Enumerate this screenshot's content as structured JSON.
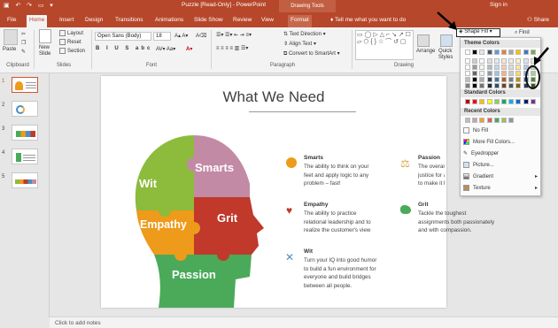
{
  "window": {
    "title": "Puzzle [Read-Only] - PowerPoint",
    "context_tab": "Drawing Tools",
    "signin": "Sign in"
  },
  "tabs": [
    "File",
    "Home",
    "Insert",
    "Design",
    "Transitions",
    "Animations",
    "Slide Show",
    "Review",
    "View",
    "Format"
  ],
  "tell_me": "Tell me what you want to do",
  "share": "Share",
  "ribbon": {
    "clipboard": {
      "paste": "Paste",
      "label": "Clipboard"
    },
    "slides": {
      "new_slide": "New Slide",
      "layout": "Layout",
      "reset": "Reset",
      "section": "Section",
      "label": "Slides"
    },
    "font": {
      "name": "Open Sans (Body)",
      "size": "18",
      "label": "Font"
    },
    "paragraph": {
      "text_direction": "Text Direction",
      "align_text": "Align Text",
      "smartart": "Convert to SmartArt",
      "label": "Paragraph"
    },
    "drawing": {
      "arrange": "Arrange",
      "quick_styles": "Quick Styles",
      "label": "Drawing",
      "shape_fill": "Shape Fill"
    },
    "editing": {
      "find": "Find"
    }
  },
  "shape_fill_menu": {
    "theme_colors": "Theme Colors",
    "standard_colors": "Standard Colors",
    "recent_colors": "Recent Colors",
    "no_fill": "No Fill",
    "more_fill_colors": "More Fill Colors...",
    "eyedropper": "Eyedropper",
    "picture": "Picture...",
    "gradient": "Gradient",
    "texture": "Texture",
    "theme_row_top": [
      "#ffffff",
      "#000000",
      "#e7e6e6",
      "#44546a",
      "#5b9bd5",
      "#ed7d31",
      "#a5a5a5",
      "#ffc000",
      "#4472c4",
      "#70ad47"
    ],
    "standard": [
      "#c00000",
      "#ff0000",
      "#ffc000",
      "#ffff00",
      "#92d050",
      "#00b050",
      "#00b0f0",
      "#0070c0",
      "#002060",
      "#7030a0"
    ],
    "recent": [
      "#bdbdbd",
      "#c9a0ba",
      "#f0a030",
      "#d86060",
      "#4aa860",
      "#a0c050",
      "#8899aa"
    ]
  },
  "slides_panel": {
    "numbers": [
      "1",
      "2",
      "3",
      "4",
      "5"
    ]
  },
  "slide": {
    "title": "What We Need",
    "puzzle": {
      "smarts": "Smarts",
      "wit": "Wit",
      "empathy": "Empathy",
      "grit": "Grit",
      "passion": "Passion"
    },
    "items": [
      {
        "title": "Smarts",
        "body": [
          "The ability to think on your",
          "feet and apply logic to any",
          "problem – fast!"
        ]
      },
      {
        "title": "Empathy",
        "body": [
          "The ability to practice",
          "relational leadership and to",
          "realize the customer's view"
        ]
      },
      {
        "title": "Wit",
        "body": [
          "Turn your IQ into good humor",
          "to build a fun environment for",
          "everyone and build bridges",
          "between all people."
        ]
      },
      {
        "title": "Passion",
        "body": [
          "The overarching",
          "justice for all, a",
          "to make it happ"
        ]
      },
      {
        "title": "Grit",
        "body": [
          "Tackle the toughest",
          "assignments both passionately",
          "and with compassion."
        ]
      }
    ]
  },
  "notes_placeholder": "Click to add notes",
  "colors": {
    "accent": "#b7472a",
    "smarts": "#c38aa5",
    "wit": "#8dbb3c",
    "empathy": "#ee9a1a",
    "grit": "#c0392b",
    "passion": "#4aaa5a"
  }
}
